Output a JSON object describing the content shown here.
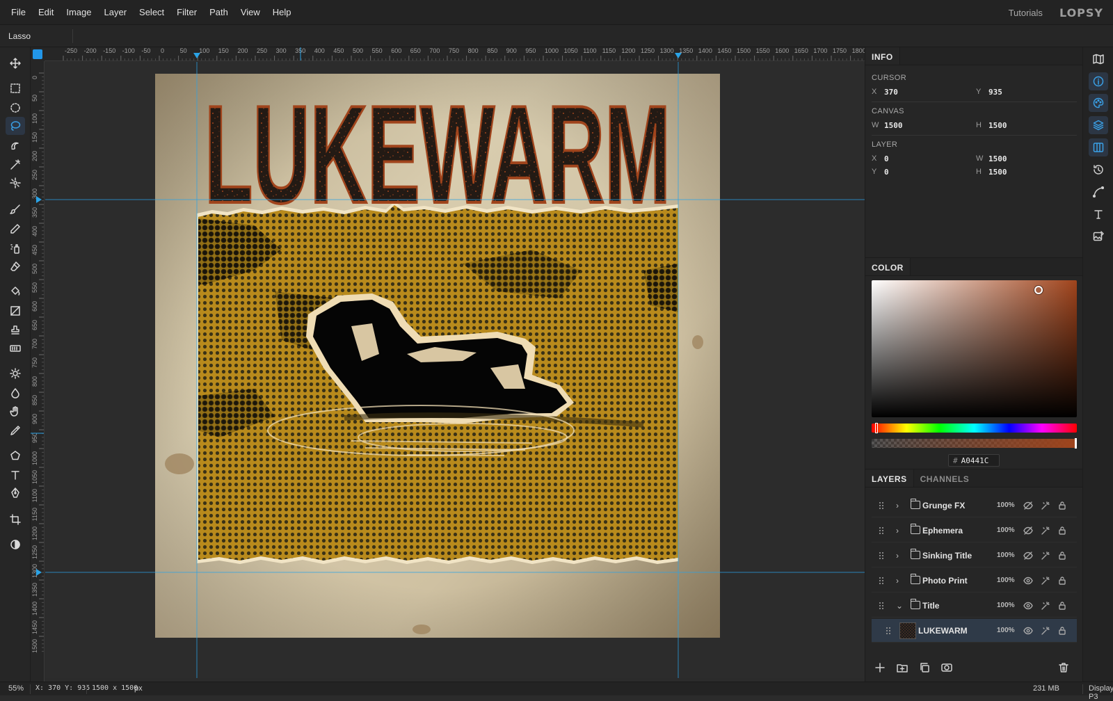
{
  "menu": [
    "File",
    "Edit",
    "Image",
    "Layer",
    "Select",
    "Filter",
    "Path",
    "View",
    "Help"
  ],
  "tutorials": "Tutorials",
  "logo": "LOPSY",
  "options": {
    "tool_name": "Lasso"
  },
  "tools": [
    {
      "icon": "move-icon"
    },
    {
      "icon": "rect-select-icon"
    },
    {
      "icon": "ellipse-select-icon"
    },
    {
      "icon": "lasso-icon",
      "active": true
    },
    {
      "icon": "quick-select-icon"
    },
    {
      "icon": "magic-wand-icon"
    },
    {
      "icon": "object-select-icon"
    },
    {
      "icon": "brush-icon"
    },
    {
      "icon": "pencil-icon"
    },
    {
      "icon": "spray-icon"
    },
    {
      "icon": "eraser-icon"
    },
    {
      "icon": "bucket-icon"
    },
    {
      "icon": "gradient-icon"
    },
    {
      "icon": "stamp-icon"
    },
    {
      "icon": "pattern-icon"
    },
    {
      "icon": "dodge-icon"
    },
    {
      "icon": "blur-icon"
    },
    {
      "icon": "hand-icon"
    },
    {
      "icon": "eyedropper-icon"
    },
    {
      "icon": "shape-icon"
    },
    {
      "icon": "text-icon"
    },
    {
      "icon": "pen-icon"
    },
    {
      "icon": "crop-icon"
    },
    {
      "icon": "contrast-icon"
    }
  ],
  "ruler": {
    "h_labels": [
      "-250",
      "-200",
      "-150",
      "-100",
      "-50",
      "0",
      "50",
      "100",
      "150",
      "200",
      "250",
      "300",
      "350",
      "400",
      "450",
      "500",
      "550",
      "600",
      "650",
      "700",
      "750",
      "800",
      "850",
      "900",
      "950",
      "1000",
      "1050",
      "1100",
      "1150",
      "1200",
      "1250",
      "1300",
      "1350",
      "1400",
      "1450",
      "1500",
      "1550",
      "1600",
      "1650",
      "1700",
      "1750",
      "1800"
    ],
    "v_labels": [
      "0",
      "50",
      "100",
      "150",
      "200",
      "250",
      "300",
      "350",
      "400",
      "450",
      "500",
      "550",
      "600",
      "650",
      "700",
      "750",
      "800",
      "850",
      "900",
      "950",
      "1000",
      "1050",
      "1100",
      "1150",
      "1200",
      "1250",
      "1300",
      "1350",
      "1400",
      "1450",
      "1500"
    ]
  },
  "artwork": {
    "title": "LUKEWARM"
  },
  "info": {
    "tab": "INFO",
    "cursor_label": "CURSOR",
    "cursor_x": "370",
    "cursor_y": "935",
    "canvas_label": "CANVAS",
    "canvas_w": "1500",
    "canvas_h": "1500",
    "layer_label": "LAYER",
    "layer_x": "0",
    "layer_y": "0",
    "layer_w": "1500",
    "layer_h": "1500",
    "x": "X",
    "y": "Y",
    "w": "W",
    "h": "H"
  },
  "color": {
    "tab": "COLOR",
    "hash": "#",
    "hex": "A0441C",
    "value": "#a0441c"
  },
  "layers": {
    "tabs": [
      "LAYERS",
      "CHANNELS"
    ],
    "rows": [
      {
        "name": "Grunge FX",
        "opacity": "100%",
        "visible": false,
        "type": "group",
        "expanded": false
      },
      {
        "name": "Ephemera",
        "opacity": "100%",
        "visible": false,
        "type": "group",
        "expanded": false
      },
      {
        "name": "Sinking Title",
        "opacity": "100%",
        "visible": false,
        "type": "group",
        "expanded": false
      },
      {
        "name": "Photo Print",
        "opacity": "100%",
        "visible": true,
        "type": "group",
        "expanded": false
      },
      {
        "name": "Title",
        "opacity": "100%",
        "visible": true,
        "type": "group",
        "expanded": true
      },
      {
        "name": "LUKEWARM",
        "opacity": "100%",
        "visible": true,
        "type": "layer",
        "selected": true
      }
    ]
  },
  "status": {
    "zoom": "55%",
    "coords": "X: 370 Y: 935",
    "size": "1500 x 1500",
    "unit": "px",
    "memory": "231 MB",
    "profile": "Display P3"
  }
}
